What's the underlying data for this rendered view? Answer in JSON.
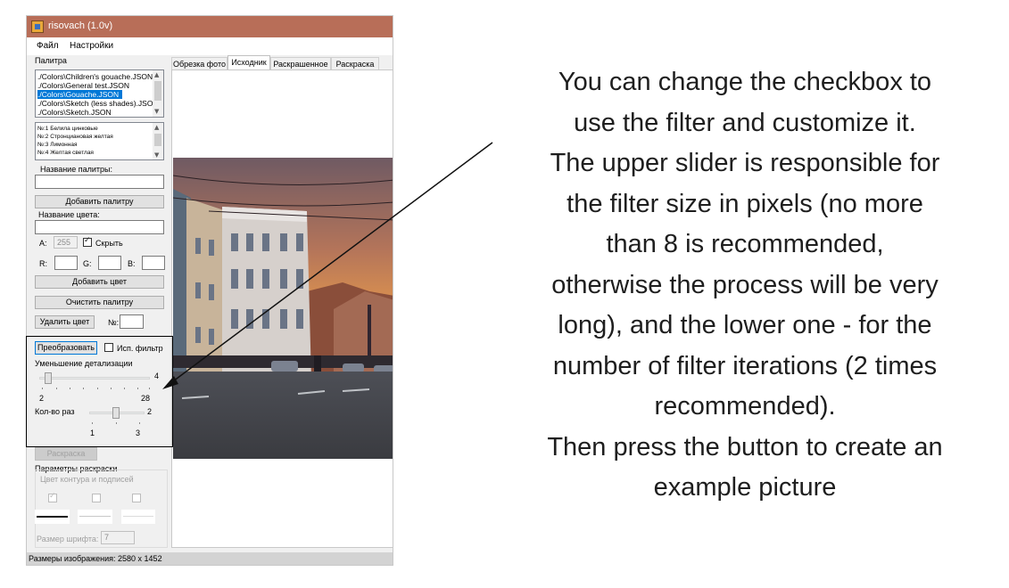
{
  "window": {
    "title": "risovach (1.0v)"
  },
  "menu": {
    "file": "Файл",
    "settings": "Настройки"
  },
  "palette": {
    "group_label": "Палитра",
    "files": [
      "./Colors\\Children's gouache.JSON",
      "./Colors\\General test.JSON",
      "./Colors\\Gouache.JSON",
      "./Colors\\Sketch (less shades).JSO",
      "./Colors\\Sketch.JSON"
    ],
    "selected_file_index": 2,
    "colors": [
      "№:1 Белила цинковые",
      "№:2 Стронциановая желтая",
      "№:3 Лимонная",
      "№:4 Желтая светлая"
    ],
    "palette_name_label": "Название палитры:",
    "palette_name_value": "",
    "add_palette_button": "Добавить палитру",
    "color_name_label": "Название цвета:",
    "color_name_value": "",
    "a_label": "A:",
    "a_value": "255",
    "hide_label": "Скрыть",
    "hide_checked": true,
    "r_label": "R:",
    "g_label": "G:",
    "b_label": "B:",
    "r_value": "",
    "g_value": "",
    "b_value": "",
    "add_color_button": "Добавить цвет",
    "clear_palette_button": "Очистить палитру",
    "delete_color_button": "Удалить цвет",
    "number_label": "№:",
    "number_value": ""
  },
  "filter": {
    "convert_button": "Преобразовать",
    "use_filter_label": "Исп. фильтр",
    "use_filter_checked": false,
    "detail_label": "Уменьшение детализации",
    "detail_value": 4,
    "detail_min": "2",
    "detail_max": "28",
    "detail_value_label": "4",
    "times_label": "Кол-во раз",
    "times_value": 2,
    "times_min": "1",
    "times_max": "3",
    "times_value_label": "2"
  },
  "coloring": {
    "button": "Раскраска",
    "params_label": "Параметры раскраски",
    "outline_label": "Цвет контура и подписей",
    "checkboxes": [
      true,
      false,
      false
    ],
    "font_size_label": "Размер шрифта:",
    "font_size_value": "7"
  },
  "tabs": [
    "Обрезка фото",
    "Исходник",
    "Раскрашенное",
    "Раскраска"
  ],
  "active_tab": 1,
  "status": {
    "text": "Размеры изображения: 2580 x 1452"
  },
  "annotation": {
    "lines": [
      "You can change the checkbox to",
      "use the filter and customize it.",
      "The upper slider is responsible for",
      "the filter size in pixels (no more",
      "than 8 is recommended,",
      "otherwise the process will be very",
      "long), and the lower one - for the",
      "number of filter iterations (2 times",
      "recommended).",
      "Then press the button to create an",
      "example picture"
    ]
  }
}
